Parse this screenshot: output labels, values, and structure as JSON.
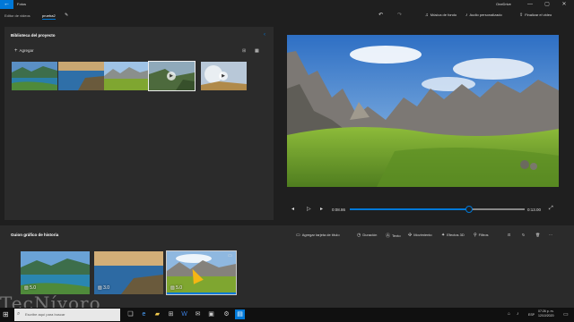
{
  "app": {
    "title": "Fotos",
    "onedrive": "OneDrive"
  },
  "window_controls": {
    "minimize": "—",
    "maximize": "▢",
    "close": "✕"
  },
  "breadcrumb": {
    "parent": "Editor de videos",
    "current": "prueba2"
  },
  "toolbar": {
    "music": "Música de fondo",
    "custom_audio": "Audio personalizado",
    "finish": "Finalizar el video"
  },
  "library": {
    "title": "Biblioteca del proyecto",
    "add_label": "Agregar",
    "items": [
      {
        "kind": "photo",
        "scene": "lake"
      },
      {
        "kind": "photo",
        "scene": "coast"
      },
      {
        "kind": "photo",
        "scene": "valley"
      },
      {
        "kind": "video",
        "scene": "cliff"
      },
      {
        "kind": "video",
        "scene": "sky"
      }
    ]
  },
  "player": {
    "current_time": "0:08.86",
    "total_time": "0:13.00",
    "progress": 0.68
  },
  "storyboard": {
    "title": "Guion gráfico de historia",
    "tools": {
      "title_card": "Agregar tarjeta de título",
      "duration": "Duración",
      "text": "Texto",
      "motion": "Movimiento",
      "effects3d": "Efectos 3D",
      "filters": "Filtros"
    },
    "cards": [
      {
        "duration": "5.0",
        "scene": "lake"
      },
      {
        "duration": "3.0",
        "scene": "coast"
      },
      {
        "duration": "5.0",
        "scene": "valley"
      }
    ]
  },
  "watermark": "TecNívoro",
  "taskbar": {
    "search_placeholder": "Escribe aquí para buscar",
    "language": "ESP",
    "time": "07:26 p. m.",
    "date": "12/10/2020"
  },
  "colors": {
    "accent": "#0078d7",
    "panel": "#2b2b2b",
    "background": "#1f1f1f"
  }
}
